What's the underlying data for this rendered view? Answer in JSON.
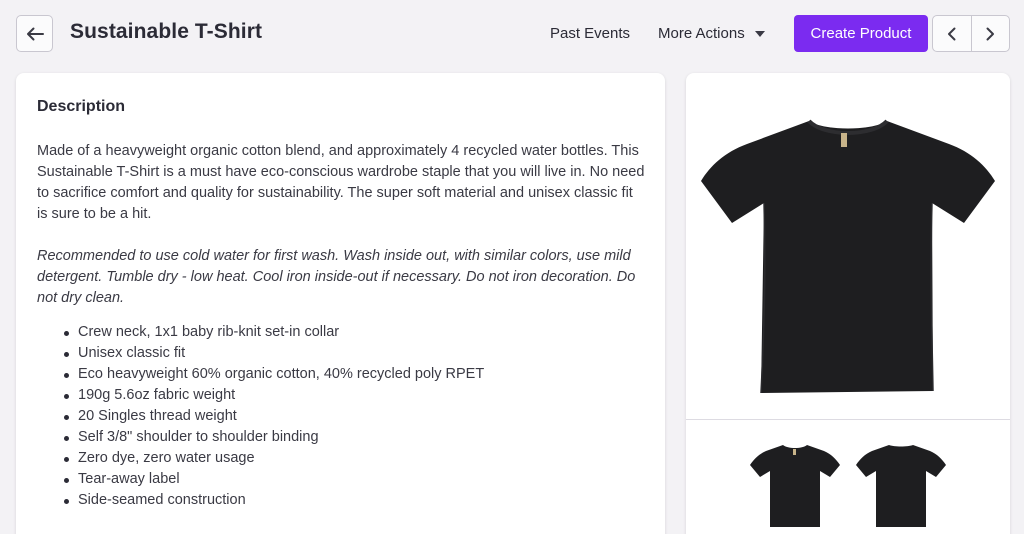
{
  "header": {
    "title": "Sustainable T-Shirt",
    "past_events": "Past Events",
    "more_actions": "More Actions",
    "create_product": "Create Product"
  },
  "description": {
    "heading": "Description",
    "paragraph": "Made of a heavyweight organic cotton blend, and approximately 4 recycled water bottles. This Sustainable T-Shirt is a must have eco-conscious wardrobe staple that you will live in. No need to sacrifice comfort and quality for sustainability. The super soft material and unisex classic fit is sure to be a hit.",
    "care": "Recommended to use cold water for first wash.  Wash inside out, with similar colors, use mild detergent. Tumble dry - low heat. Cool iron inside-out if necessary. Do not iron decoration. Do not dry clean.",
    "features": [
      "Crew neck, 1x1 baby rib-knit set-in collar",
      "Unisex classic fit",
      "Eco heavyweight 60% organic cotton, 40% recycled poly RPET",
      "190g 5.6oz fabric weight",
      "20 Singles thread weight",
      "Self 3/8\" shoulder to shoulder binding",
      "Zero dye, zero water usage",
      "Tear-away label",
      "Side-seamed construction"
    ]
  },
  "colors": {
    "accent": "#7b2bf0",
    "background": "#f3f2f5",
    "shirt": "#1e1e20"
  },
  "icons": {
    "back": "arrow-left-icon",
    "prev": "chevron-left-icon",
    "next": "chevron-right-icon",
    "dropdown": "caret-down-icon"
  }
}
